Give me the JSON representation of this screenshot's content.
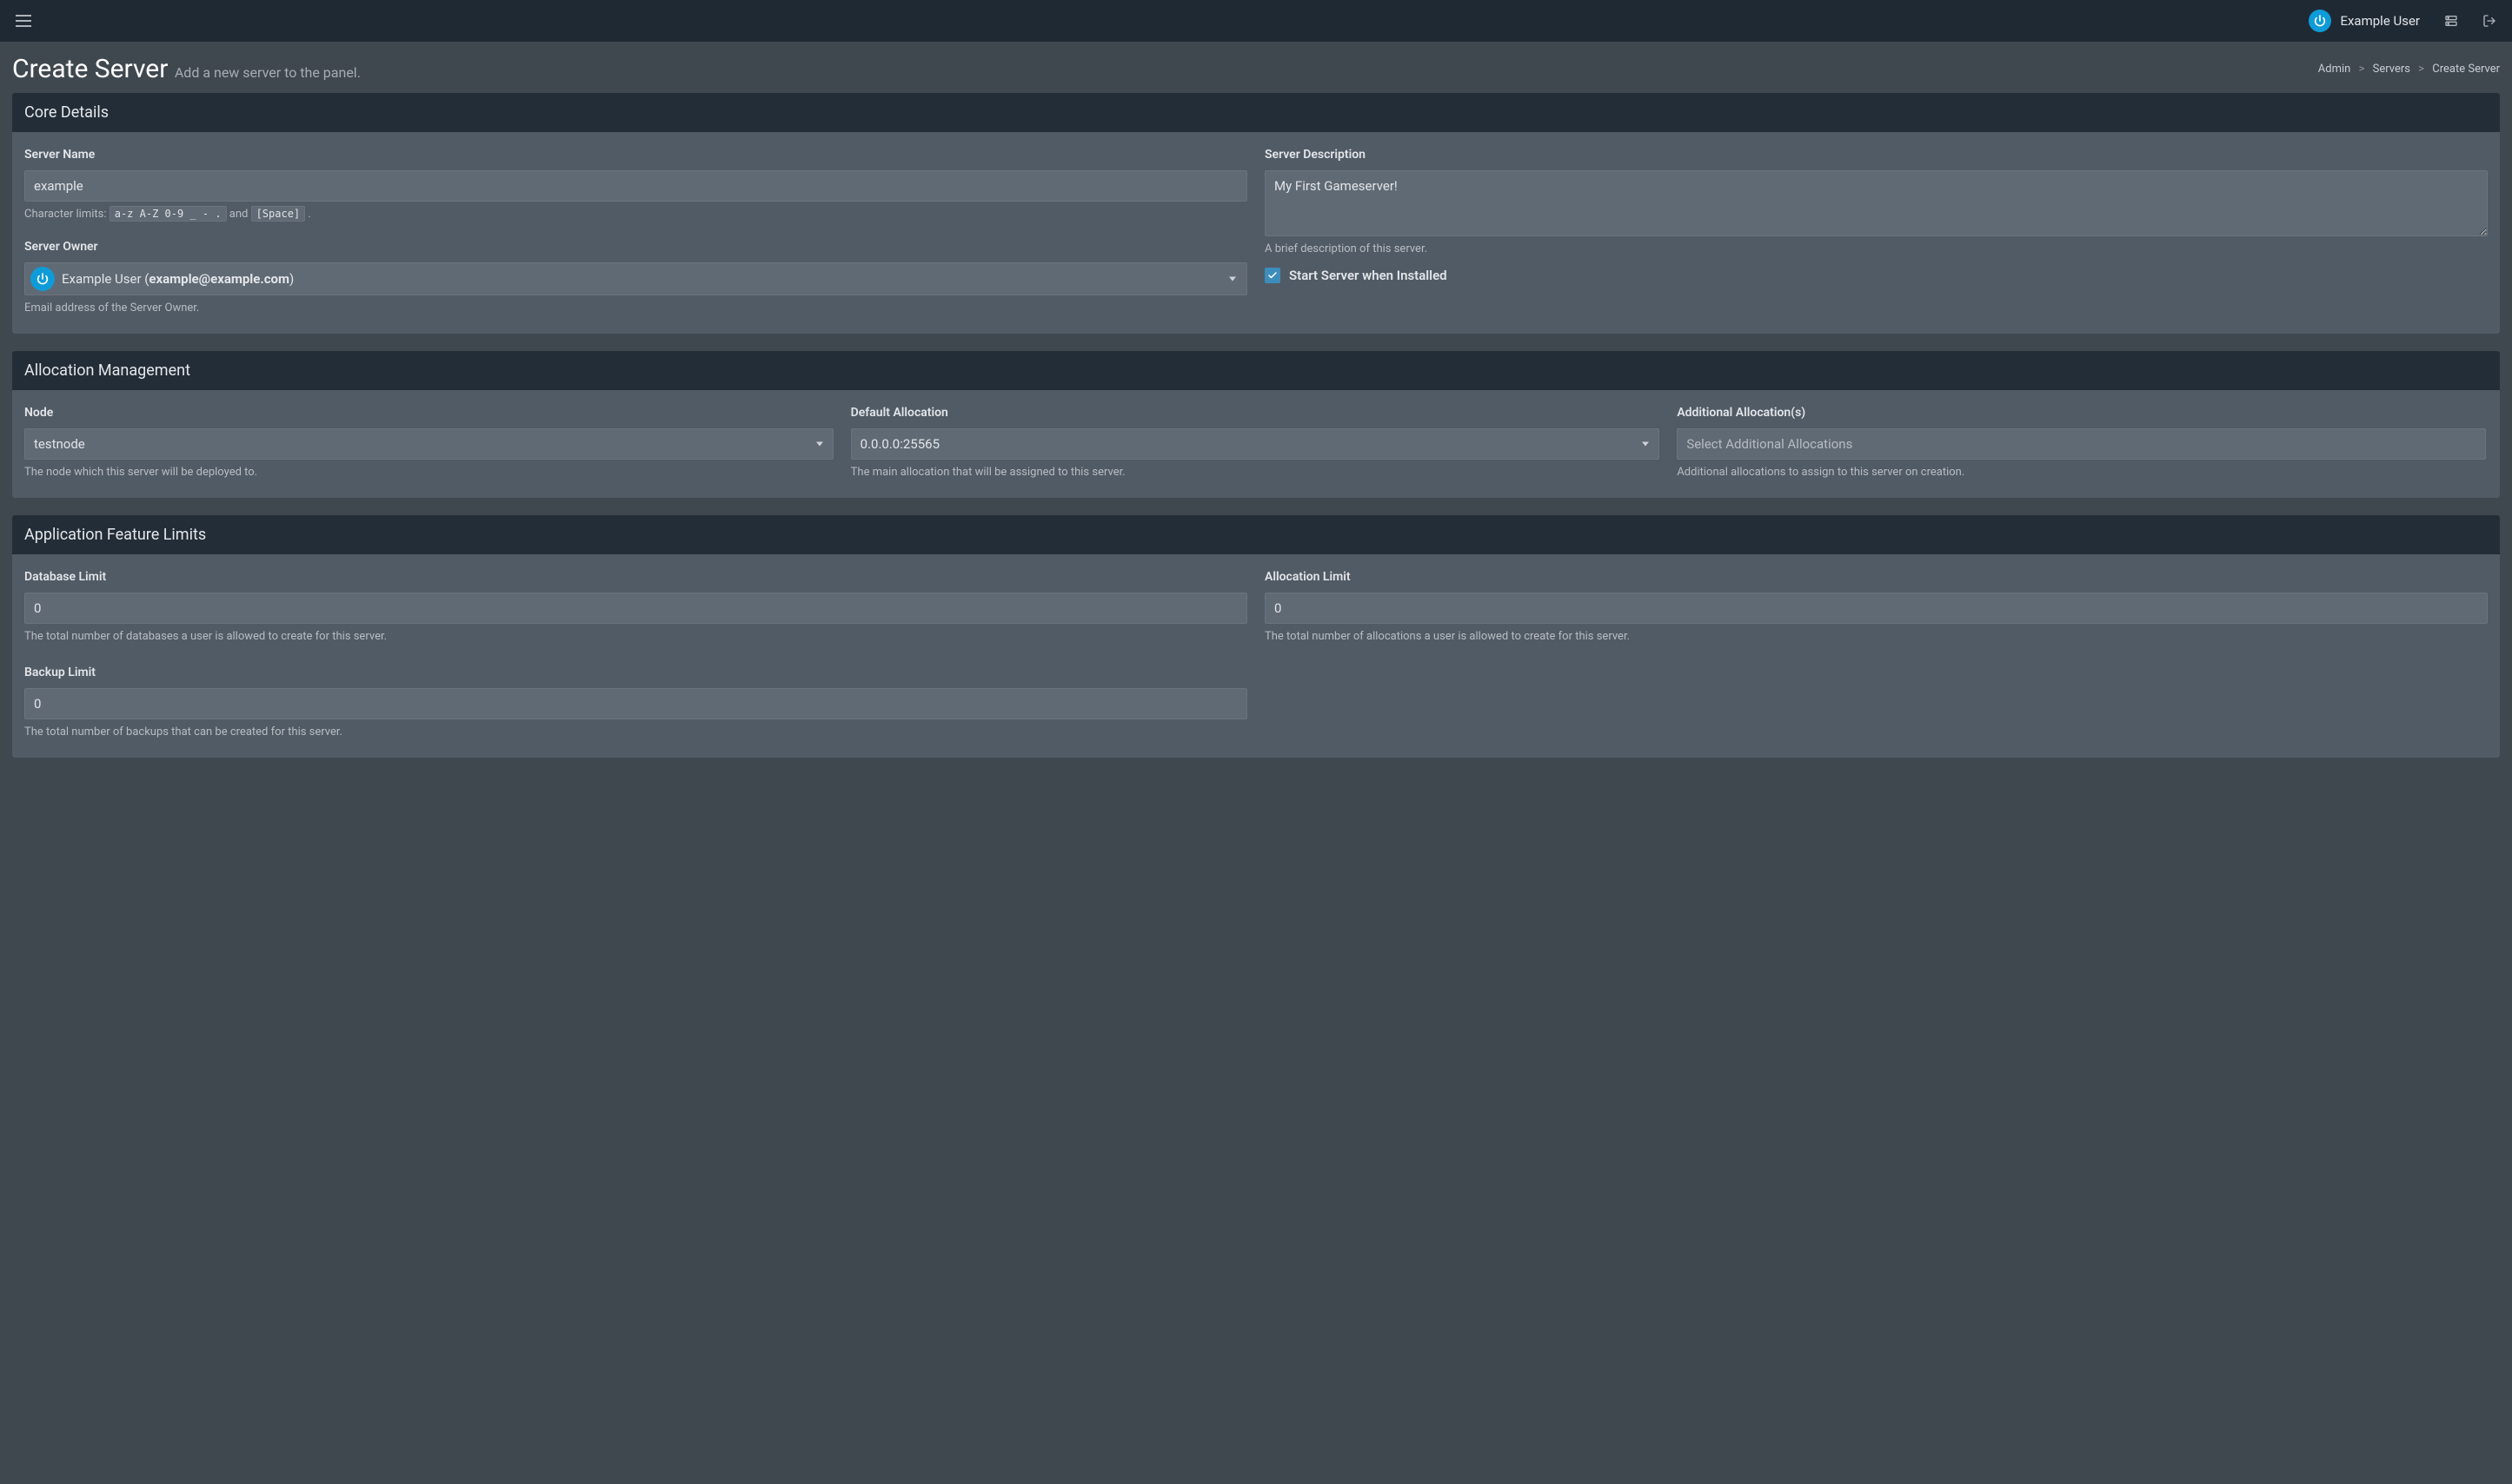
{
  "topbar": {
    "username": "Example User"
  },
  "header": {
    "title": "Create Server",
    "subtitle": "Add a new server to the panel.",
    "breadcrumb": {
      "admin": "Admin",
      "servers": "Servers",
      "current": "Create Server"
    }
  },
  "core": {
    "panel_title": "Core Details",
    "server_name_label": "Server Name",
    "server_name_value": "example",
    "char_limits_prefix": "Character limits: ",
    "char_limits_code1": "a-z A-Z 0-9 _ - .",
    "char_limits_and": " and ",
    "char_limits_code2": "[Space]",
    "char_limits_suffix": " .",
    "owner_label": "Server Owner",
    "owner_text_prefix": "Example User (",
    "owner_text_email": "example@example.com",
    "owner_text_suffix": ")",
    "owner_help": "Email address of the Server Owner.",
    "desc_label": "Server Description",
    "desc_value": "My First Gameserver!",
    "desc_help": "A brief description of this server.",
    "start_label": "Start Server when Installed"
  },
  "alloc": {
    "panel_title": "Allocation Management",
    "node_label": "Node",
    "node_value": "testnode",
    "node_help": "The node which this server will be deployed to.",
    "default_label": "Default Allocation",
    "default_value": "0.0.0.0:25565",
    "default_help": "The main allocation that will be assigned to this server.",
    "additional_label": "Additional Allocation(s)",
    "additional_placeholder": "Select Additional Allocations",
    "additional_help": "Additional allocations to assign to this server on creation."
  },
  "limits": {
    "panel_title": "Application Feature Limits",
    "db_label": "Database Limit",
    "db_value": "0",
    "db_help": "The total number of databases a user is allowed to create for this server.",
    "alloc_label": "Allocation Limit",
    "alloc_value": "0",
    "alloc_help": "The total number of allocations a user is allowed to create for this server.",
    "backup_label": "Backup Limit",
    "backup_value": "0",
    "backup_help": "The total number of backups that can be created for this server."
  }
}
